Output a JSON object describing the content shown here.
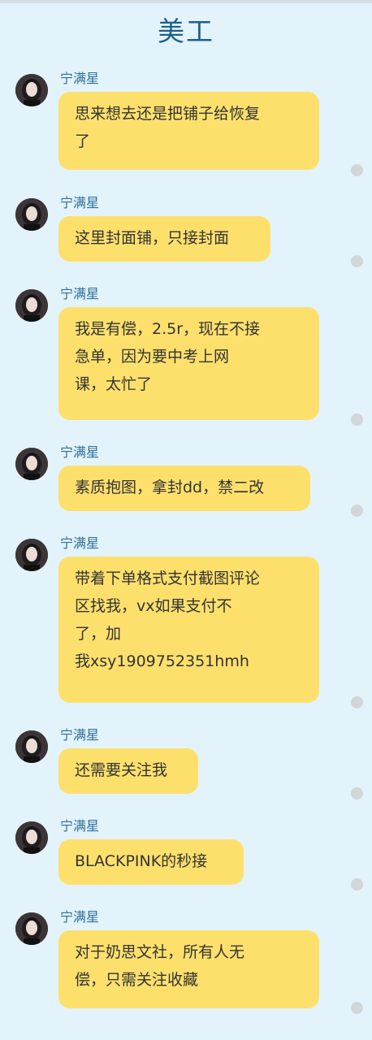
{
  "header": {
    "title": "美工"
  },
  "chat": {
    "messages": [
      {
        "sender": "宁满星",
        "lines": [
          "思来想去还是把铺子给恢复",
          "了"
        ]
      },
      {
        "sender": "宁满星",
        "lines": [
          "这里封面铺，只接封面"
        ]
      },
      {
        "sender": "宁满星",
        "lines": [
          "我是有偿，2.5r，现在不接",
          "急单，因为要中考上网",
          "课，太忙了"
        ]
      },
      {
        "sender": "宁满星",
        "lines": [
          "素质抱图，拿封dd，禁二改"
        ]
      },
      {
        "sender": "宁满星",
        "lines": [
          "带着下单格式支付截图评论",
          "区找我，vx如果支付不",
          "了，加",
          "我xsy1909752351hmh"
        ]
      },
      {
        "sender": "宁满星",
        "lines": [
          "还需要关注我"
        ]
      },
      {
        "sender": "宁满星",
        "lines": [
          "BLACKPINK的秒接"
        ]
      },
      {
        "sender": "宁满星",
        "lines": [
          "对于奶思文社，所有人无",
          "偿，只需关注收藏"
        ]
      }
    ]
  },
  "colors": {
    "background": "#e3f3fb",
    "bubble": "#fde06c",
    "title": "#1e5f8e",
    "sender": "#2f6f9b"
  }
}
